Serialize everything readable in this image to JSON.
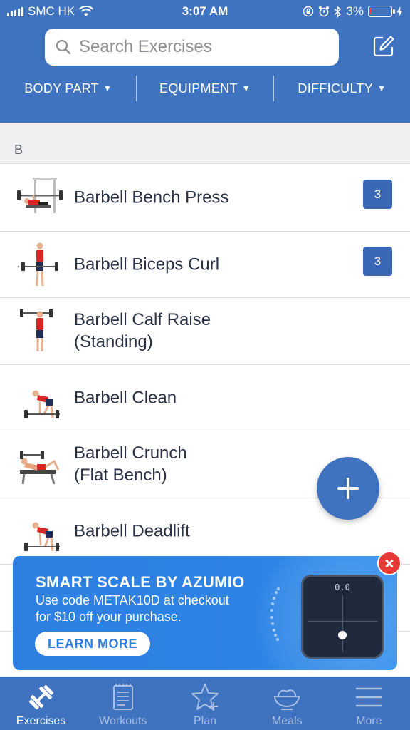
{
  "status_bar": {
    "carrier": "SMC HK",
    "time": "3:07 AM",
    "battery": "3%",
    "battery_level": 0.03
  },
  "search": {
    "placeholder": "Search Exercises",
    "value": ""
  },
  "filters": [
    {
      "label": "BODY PART"
    },
    {
      "label": "EQUIPMENT"
    },
    {
      "label": "DIFFICULTY"
    }
  ],
  "section": {
    "letter": "B"
  },
  "exercises": [
    {
      "name": "Barbell Bench Press",
      "badge": "3"
    },
    {
      "name": "Barbell Biceps Curl",
      "badge": "3"
    },
    {
      "name": "Barbell Calf Raise\n(Standing)",
      "badge": ""
    },
    {
      "name": "Barbell Clean",
      "badge": ""
    },
    {
      "name": "Barbell Crunch\n(Flat Bench)",
      "badge": ""
    },
    {
      "name": "Barbell Deadlift",
      "badge": ""
    }
  ],
  "ad": {
    "title": "SMART SCALE BY AZUMIO",
    "line1": "Use code METAK10D at checkout",
    "line2": "for $10 off your purchase.",
    "cta": "LEARN MORE",
    "scale_readout": "0.0"
  },
  "tabs": [
    {
      "label": "Exercises",
      "icon": "dumbbell-icon",
      "active": true
    },
    {
      "label": "Workouts",
      "icon": "notepad-icon",
      "active": false
    },
    {
      "label": "Plan",
      "icon": "star-plus-icon",
      "active": false
    },
    {
      "label": "Meals",
      "icon": "bowl-icon",
      "active": false
    },
    {
      "label": "More",
      "icon": "hamburger-menu-icon",
      "active": false
    }
  ],
  "colors": {
    "primary": "#3f72bf",
    "badge": "#3a68b4",
    "ad_background": "#2f7fe0",
    "close": "#e53935"
  }
}
